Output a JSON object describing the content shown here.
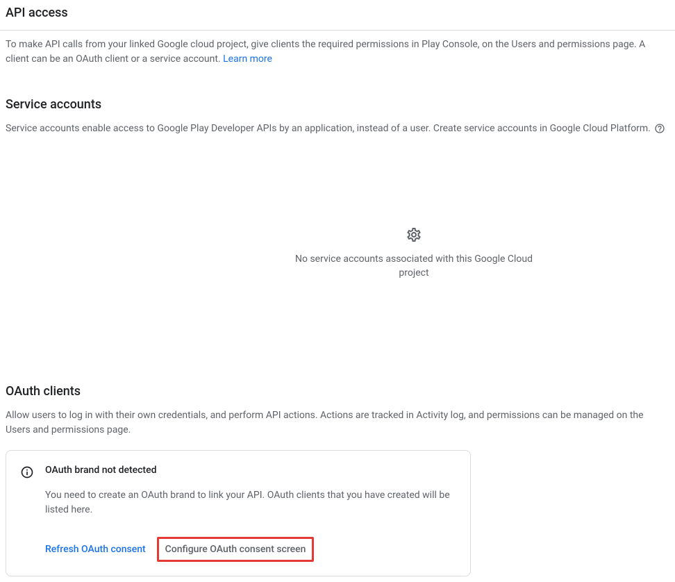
{
  "api_access": {
    "title": "API access",
    "description": "To make API calls from your linked Google cloud project, give clients the required permissions in Play Console, on the Users and permissions page. A client can be an OAuth client or a service account.",
    "learn_more": "Learn more"
  },
  "service_accounts": {
    "title": "Service accounts",
    "description": "Service accounts enable access to Google Play Developer APIs by an application, instead of a user. Create service accounts in Google Cloud Platform.",
    "empty_state": "No service accounts associated with this Google Cloud project"
  },
  "oauth_clients": {
    "title": "OAuth clients",
    "description": "Allow users to log in with their own credentials, and perform API actions. Actions are tracked in Activity log, and permissions can be managed on the Users and permissions page.",
    "card": {
      "title": "OAuth brand not detected",
      "description": "You need to create an OAuth brand to link your API. OAuth clients that you have created will be listed here.",
      "refresh_button": "Refresh OAuth consent",
      "configure_button": "Configure OAuth consent screen"
    }
  }
}
